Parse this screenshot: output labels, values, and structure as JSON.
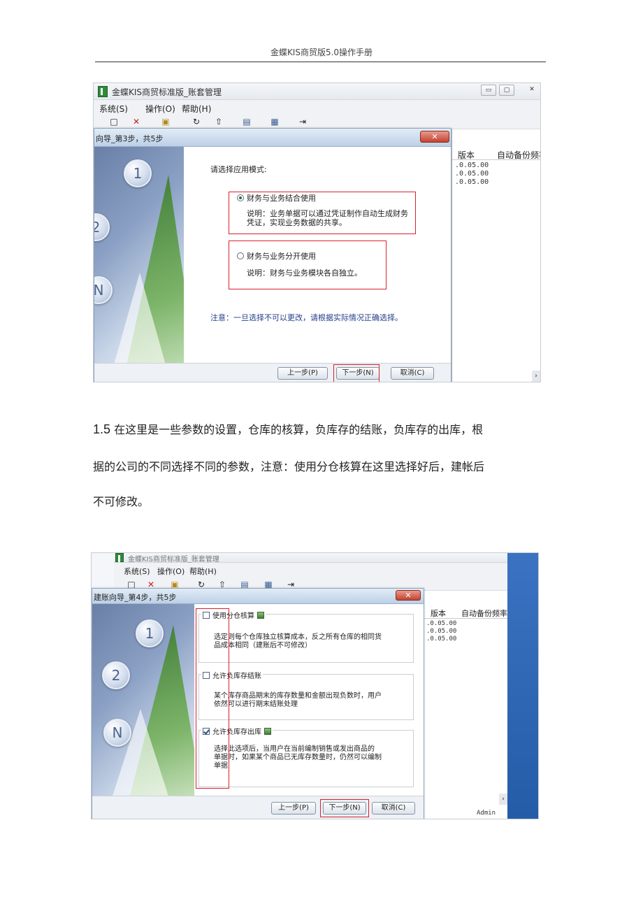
{
  "header": {
    "title": "金蝶KIS商贸版5.0操作手册"
  },
  "screenshot1": {
    "app_title": "金蝶KIS商贸标准版_账套管理",
    "window_controls": [
      "▭",
      "▢",
      "✕"
    ],
    "menu": [
      "系统(S)",
      "操作(O)",
      "帮助(H)"
    ],
    "toolbar_icons": [
      "new-icon",
      "delete-icon",
      "open-icon",
      "refresh-icon",
      "up-icon",
      "backup-icon",
      "restore-icon",
      "exit-icon"
    ],
    "right_panel": {
      "col_version": "版本",
      "col_backup": "自动备份频率",
      "rows": [
        ".0.05.00",
        ".0.05.00",
        ".0.05.00"
      ]
    },
    "dialog": {
      "title": "向导_第3步，共5步",
      "close": "✕",
      "steps": [
        "1",
        "2",
        "N"
      ],
      "prompt": "请选择应用模式:",
      "option1": {
        "label": "财务与业务结合使用",
        "desc_line1": "说明：业务单据可以通过凭证制作自动生成财务",
        "desc_line2": "凭证，实现业务数据的共享。"
      },
      "option2": {
        "label": "财务与业务分开使用",
        "desc": "说明：财务与业务模块各自独立。"
      },
      "note": "注意：一旦选择不可以更改，请根据实际情况正确选择。",
      "buttons": {
        "prev": "上一步(P)",
        "next": "下一步(N)",
        "cancel": "取消(C)"
      }
    }
  },
  "paragraph": {
    "number": "1.5",
    "line1": "在这里是一些参数的设置，仓库的核算，负库存的结账，负库存的出库，根",
    "line2": "据的公司的不同选择不同的参数，注意：使用分仓核算在这里选择好后，建帐后",
    "line3": "不可修改。"
  },
  "screenshot2": {
    "app_title": "金蝶KIS商贸标准版_账套管理",
    "menu": [
      "系统(S)",
      "操作(O)",
      "帮助(H)"
    ],
    "right_panel": {
      "col_version": "版本",
      "col_backup": "自动备份频率",
      "rows": [
        ".0.05.00",
        ".0.05.00",
        ".0.05.00"
      ],
      "status": "Admin"
    },
    "dialog": {
      "title": "建账向导_第4步，共5步",
      "close": "✕",
      "steps": [
        "1",
        "2",
        "N"
      ],
      "opt1": {
        "label": "使用分仓核算",
        "checked": false,
        "desc_line1": "选定则每个仓库独立核算成本，反之所有仓库的相同货",
        "desc_line2": "品成本相同（建账后不可修改）"
      },
      "opt2": {
        "label": "允许负库存结账",
        "checked": false,
        "desc_line1": "某个库存商品期末的库存数量和金额出现负数时，用户",
        "desc_line2": "依然可以进行期末结账处理"
      },
      "opt3": {
        "label": "允许负库存出库",
        "checked": true,
        "desc_line1": "选择此选项后，当用户在当前编制销售或发出商品的",
        "desc_line2": "单据时，如果某个商品已无库存数量时，仍然可以编制",
        "desc_line3": "单据"
      },
      "buttons": {
        "prev": "上一步(P)",
        "next": "下一步(N)",
        "cancel": "取消(C)"
      }
    }
  }
}
